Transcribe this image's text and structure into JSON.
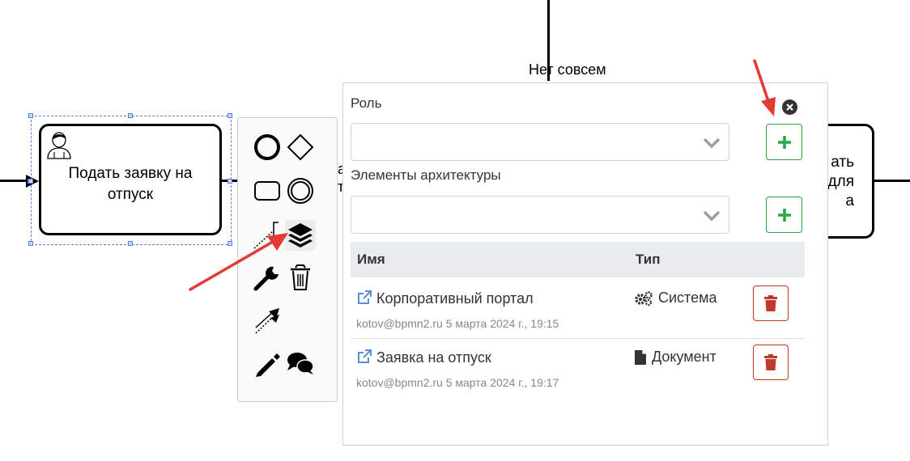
{
  "diagram": {
    "task_label": "Подать заявку на отпуск",
    "right_task_label": "ать\nдля\nа",
    "flow_label_fragment": "а\nт",
    "gateway_label": "Нет совсем"
  },
  "context_pad": {
    "tools": [
      "end-event-icon",
      "gateway-icon",
      "task-icon",
      "intermediate-event-icon",
      "text-annotation-icon",
      "layers-icon",
      "wrench-icon",
      "trash-icon",
      "connect-icon",
      "pencil-icon",
      "comments-icon"
    ]
  },
  "popup": {
    "role_label": "Роль",
    "role_value": "",
    "arch_label": "Элементы архитектуры",
    "arch_value": "",
    "table": {
      "col_name": "Имя",
      "col_type": "Тип",
      "rows": [
        {
          "name": "Корпоративный портал",
          "meta": "kotov@bpmn2.ru 5 марта 2024 г., 19:15",
          "type": "Система",
          "type_icon": "cogs-icon"
        },
        {
          "name": "Заявка на отпуск",
          "meta": "kotov@bpmn2.ru 5 марта 2024 г., 19:17",
          "type": "Документ",
          "type_icon": "document-icon"
        }
      ]
    }
  },
  "colors": {
    "add_green": "#28a745",
    "delete_red": "#c0392b",
    "link_blue": "#5b8ed8",
    "selection_blue": "#5b7fdc",
    "annotation_arrow": "#e53935"
  }
}
